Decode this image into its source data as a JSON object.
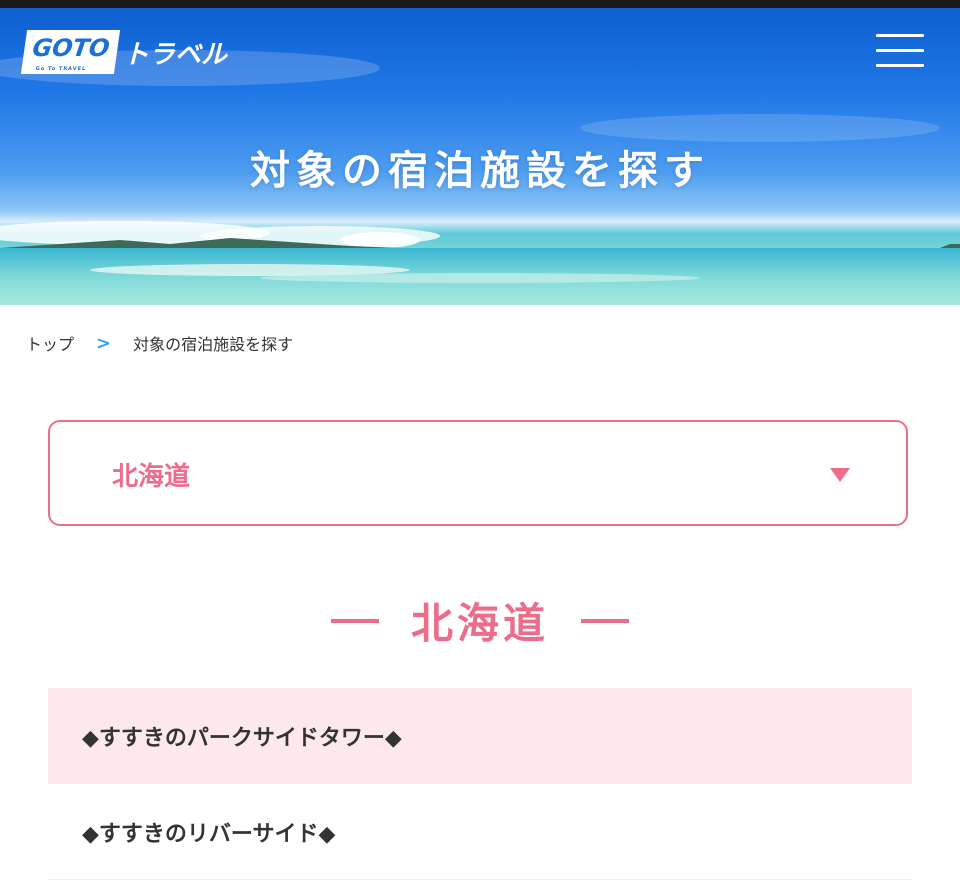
{
  "header": {
    "logo_goto": "GOTO",
    "logo_subtext": "Go To TRAVEL",
    "logo_text": "トラベル",
    "menu_icon": "hamburger-menu-icon"
  },
  "hero": {
    "title": "対象の宿泊施設を探す"
  },
  "breadcrumb": {
    "home": "トップ",
    "separator": ">",
    "current": "対象の宿泊施設を探す"
  },
  "prefecture_select": {
    "selected": "北海道",
    "caret_icon": "caret-down-icon"
  },
  "section": {
    "title": "北海道"
  },
  "facilities": [
    {
      "name": "◆すすきのパークサイドタワー◆",
      "highlighted": true
    },
    {
      "name": "◆すすきのリバーサイド◆",
      "highlighted": false
    }
  ],
  "colors": {
    "accent_pink": "#ec6d8a",
    "highlight_bg": "#fde8ec",
    "sky_blue": "#1f77e6",
    "breadcrumb_arrow": "#3aa0e8"
  }
}
